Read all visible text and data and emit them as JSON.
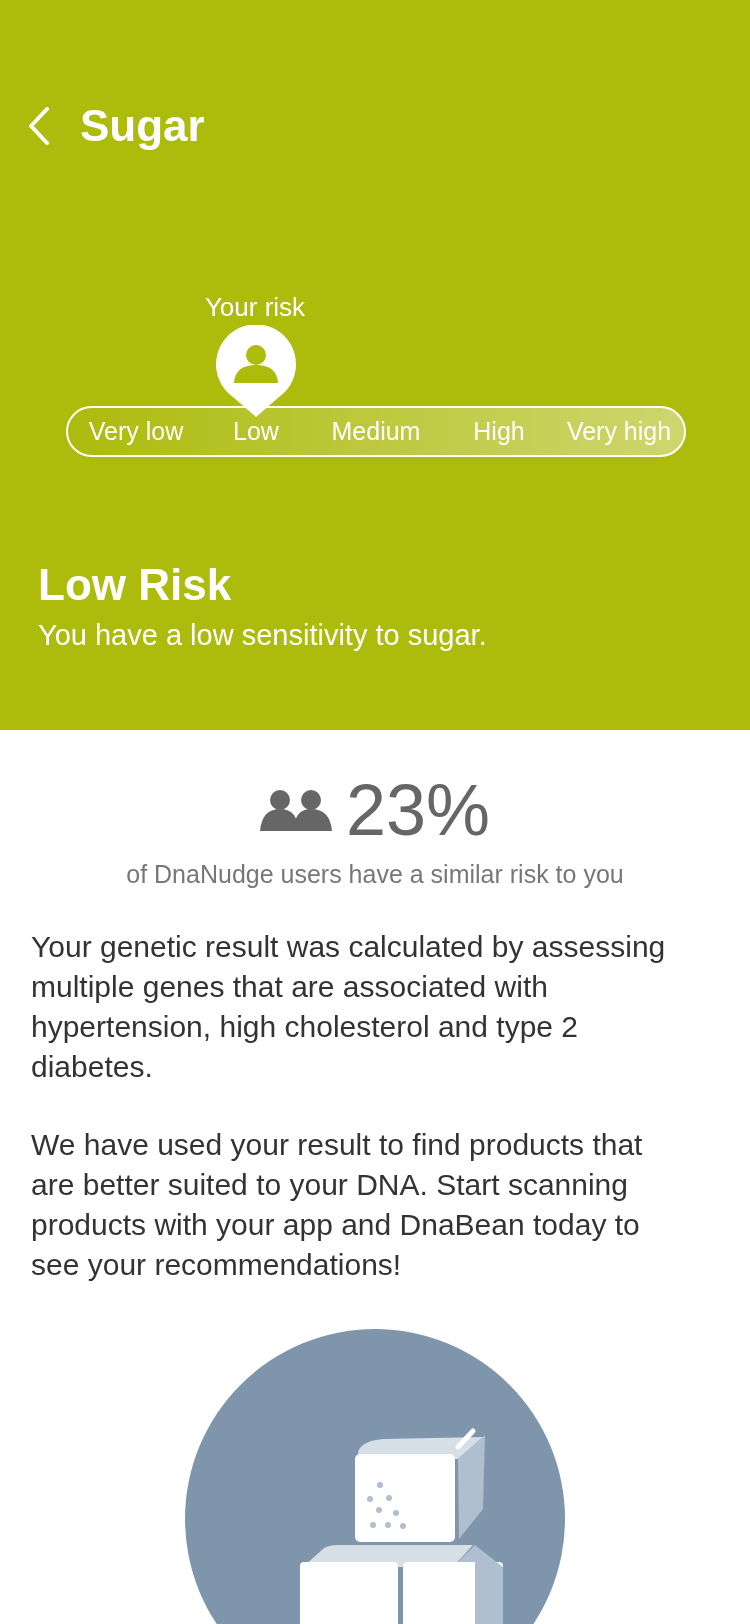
{
  "header": {
    "title": "Sugar"
  },
  "risk_scale": {
    "label": "Your risk",
    "levels": [
      {
        "label": "Very low",
        "selected": false
      },
      {
        "label": "Low",
        "selected": true
      },
      {
        "label": "Medium",
        "selected": false
      },
      {
        "label": "High",
        "selected": false
      },
      {
        "label": "Very high",
        "selected": false
      }
    ]
  },
  "result": {
    "title": "Low Risk",
    "description": "You have a low sensitivity to sugar."
  },
  "stat": {
    "value": "23%",
    "caption": "of DnaNudge users have a similar risk to you"
  },
  "paragraphs": [
    "Your genetic result was calculated by assessing multiple genes that are associated with hypertension, high cholesterol and type 2 diabetes.",
    "We have used your result to find products that are better suited to your DNA. Start scanning products with your app and DnaBean today to see your recommendations!"
  ]
}
